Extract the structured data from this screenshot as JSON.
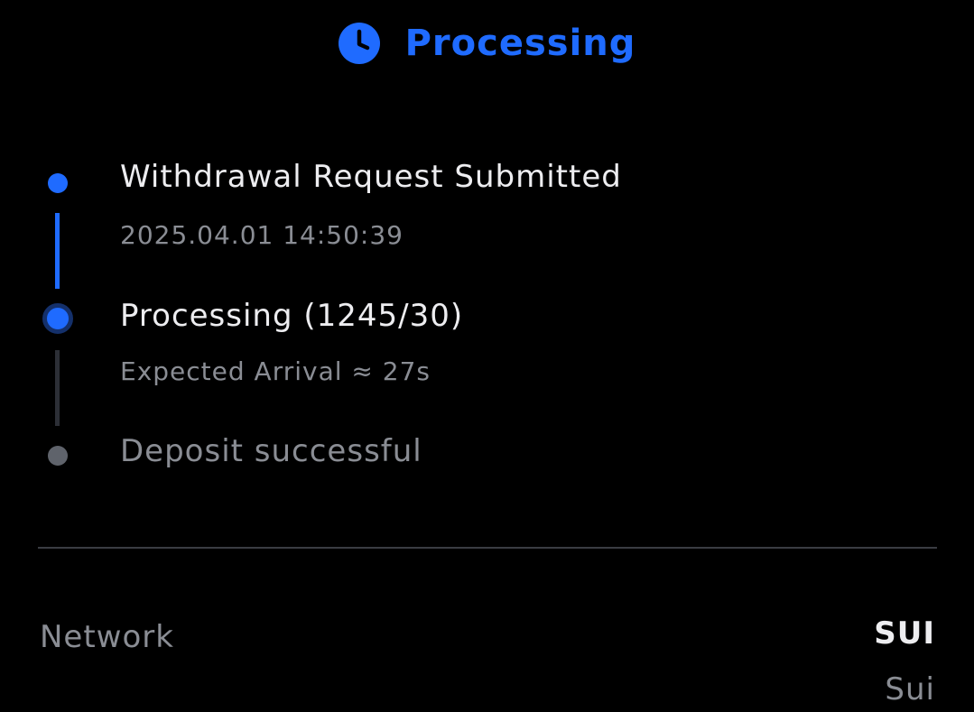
{
  "header": {
    "status_label": "Processing",
    "icon": "clock-icon",
    "accent_color": "#1f6bff"
  },
  "timeline": {
    "steps": [
      {
        "title": "Withdrawal Request Submitted",
        "subtitle": "2025.04.01 14:50:39",
        "state": "completed"
      },
      {
        "title": "Processing (1245/30)",
        "subtitle": "Expected Arrival ≈ 27s",
        "state": "active"
      },
      {
        "title": "Deposit successful",
        "state": "pending"
      }
    ]
  },
  "details": {
    "network_label": "Network",
    "network_value": "SUI",
    "network_subvalue": "Sui"
  },
  "colors": {
    "background": "#000000",
    "accent": "#1f6bff",
    "pending": "#5f636b",
    "text_primary": "#ededf0",
    "text_secondary": "#8a8d94"
  }
}
